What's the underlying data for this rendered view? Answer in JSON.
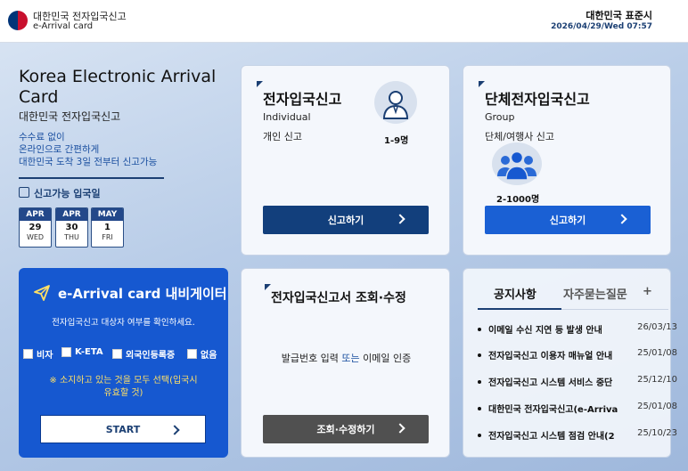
{
  "header": {
    "org_title": "대한민국 전자입국신고",
    "app_name": "e-Arrival card",
    "std_time_label": "대한민국 표준시",
    "std_time_value": "2026/04/29/Wed 07:57"
  },
  "intro": {
    "title": "Korea Electronic Arrival Card",
    "subtitle": "대한민국 전자입국신고",
    "lines": [
      "수수료 없이",
      "온라인으로 간편하게",
      "대한민국 도착 3일 전부터 신고가능"
    ],
    "dates_label": "신고가능 입국일",
    "dates": [
      {
        "month": "APR",
        "day": "29",
        "weekday": "WED"
      },
      {
        "month": "APR",
        "day": "30",
        "weekday": "THU"
      },
      {
        "month": "MAY",
        "day": "1",
        "weekday": "FRI"
      }
    ]
  },
  "individual": {
    "title": "전자입국신고",
    "type_en": "Individual",
    "type_ko": "개인 신고",
    "count": "1-9명",
    "button": "신고하기"
  },
  "group": {
    "title": "단체전자입국신고",
    "type_en": "Group",
    "type_ko": "단체/여행사 신고",
    "count": "2-1000명",
    "button": "신고하기"
  },
  "navigator": {
    "title": "e-Arrival card 내비게이터",
    "desc": "전자입국신고 대상자 여부를 확인하세요.",
    "options": [
      "비자",
      "K-ETA",
      "외국인등록증",
      "없음"
    ],
    "note_line1": "※ 소지하고 있는 것을 모두 선택(입국시",
    "note_line2": "유효할 것)",
    "start": "START"
  },
  "lookup": {
    "title": "전자입국신고서 조회·수정",
    "desc_a": "발급번호 입력",
    "desc_or": "또는",
    "desc_b": "이메일 인증",
    "button": "조회·수정하기"
  },
  "notice": {
    "tab_notice": "공지사항",
    "tab_faq": "자주묻는질문",
    "more": "+",
    "items": [
      {
        "title": "이메일 수신 지연 등 발생 안내",
        "date": "26/03/13"
      },
      {
        "title": "전자입국신고 이용자 매뉴얼 안내",
        "date": "25/01/08"
      },
      {
        "title": "전자입국신고 시스템 서비스 중단",
        "date": "25/12/10"
      },
      {
        "title": "대한민국 전자입국신고(e-Arriva",
        "date": "25/01/08"
      },
      {
        "title": "전자입국신고 시스템 점검 안내(2",
        "date": "25/10/23"
      }
    ]
  },
  "colors": {
    "brand_navy": "#1b3f73",
    "primary_blue": "#1658d0",
    "accent_yellow": "#ffe066"
  }
}
